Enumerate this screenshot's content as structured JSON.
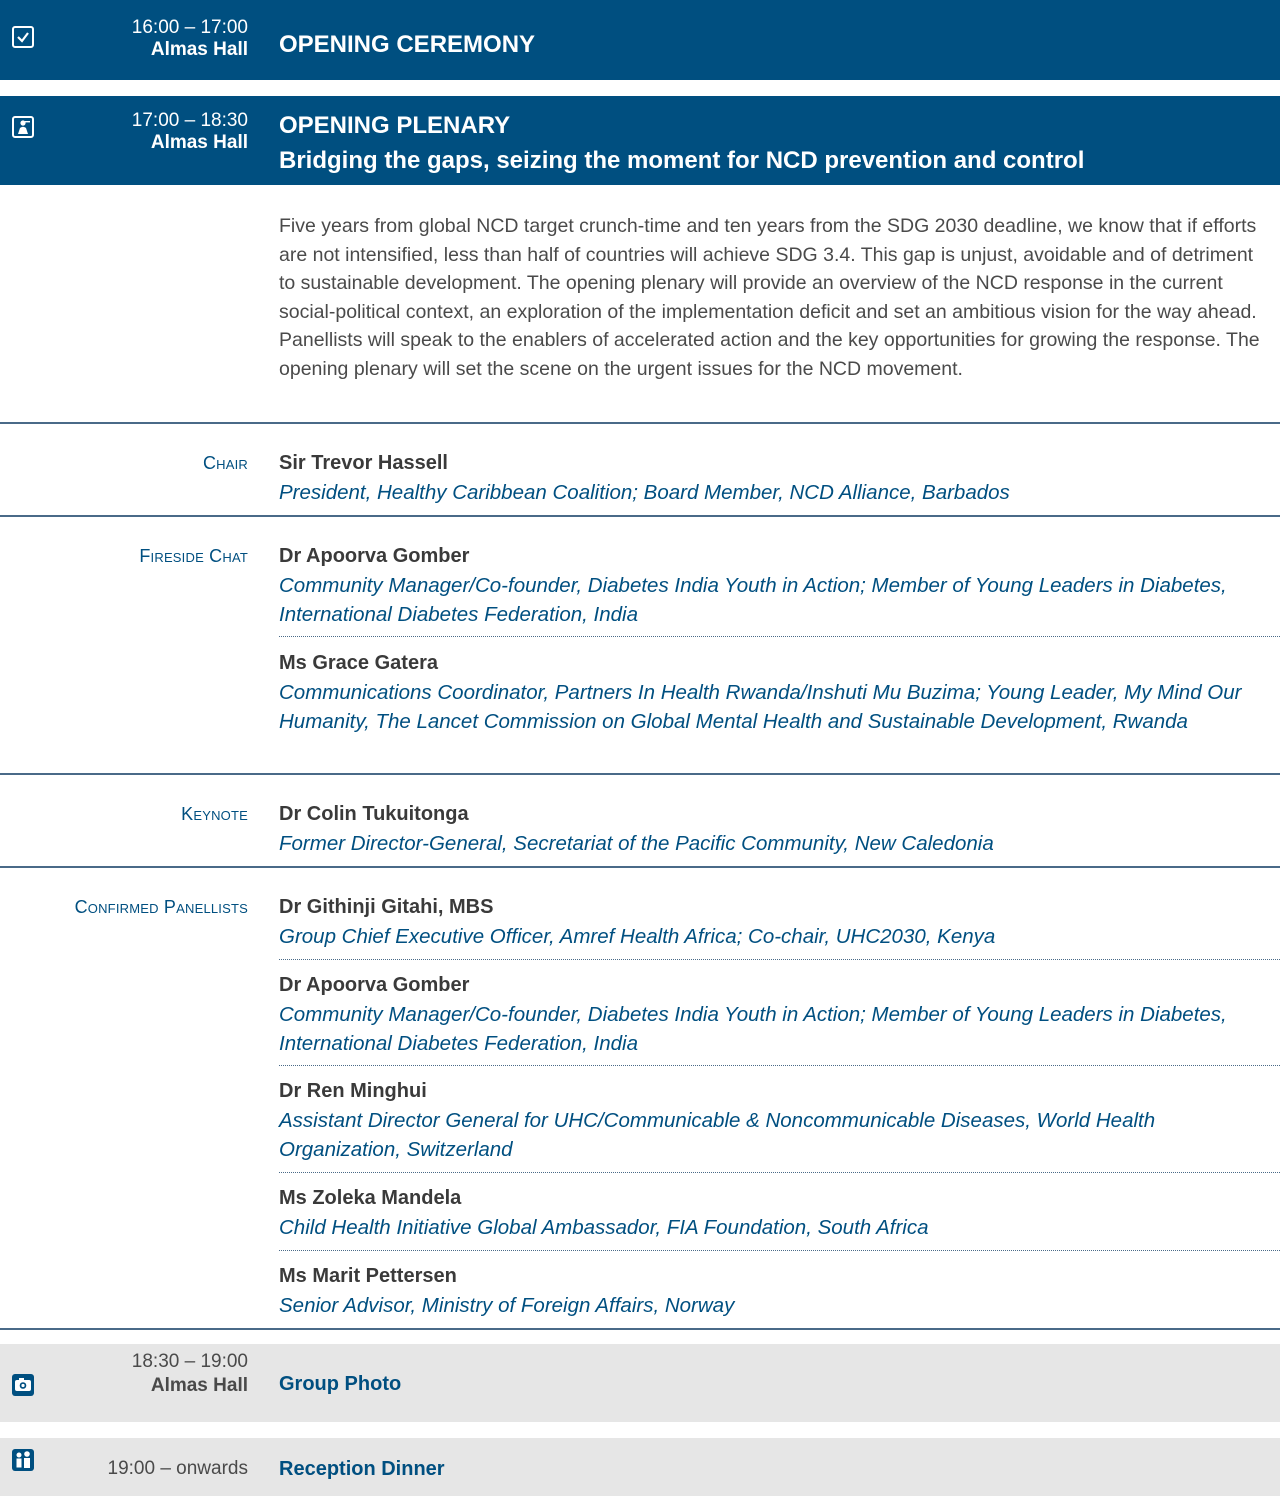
{
  "sessions": [
    {
      "time": "16:00 – 17:00",
      "venue": "Almas Hall",
      "title": "OPENING CEREMONY",
      "icon": "checkbox-icon"
    },
    {
      "time": "17:00 – 18:30",
      "venue": "Almas Hall",
      "title": "OPENING PLENARY",
      "subtitle": "Bridging the gaps, seizing the moment for NCD prevention and control",
      "icon": "presenter-icon"
    },
    {
      "time": "18:30 – 19:00",
      "venue": "Almas Hall",
      "title": "Group Photo",
      "icon": "camera-icon"
    },
    {
      "time": "19:00 – onwards",
      "title": "Reception Dinner",
      "icon": "people-icon"
    }
  ],
  "description": "Five years from global NCD target crunch-time and ten years from the SDG 2030 deadline, we know that if efforts are not intensified, less than half of countries will achieve SDG 3.4. This gap is unjust, avoidable and of detriment to sustainable development. The opening plenary will provide an overview of the NCD response in the current social-political context, an exploration of the implementation deficit and set an ambitious vision for the way ahead. Panellists will speak to the enablers of accelerated action and the key opportunities for growing the response. The opening plenary will set the scene on the urgent issues for the NCD movement.",
  "roles": {
    "chair": "Chair",
    "fireside": "Fireside Chat",
    "keynote": "Keynote",
    "panellists": "Confirmed Panellists"
  },
  "people": [
    {
      "name": "Sir Trevor Hassell",
      "affiliation": "President, Healthy Caribbean Coalition; Board Member, NCD Alliance, Barbados"
    },
    {
      "name": "Dr Apoorva Gomber",
      "affiliation": "Community Manager/Co-founder, Diabetes India Youth in Action; Member of Young Leaders in Diabetes, International Diabetes Federation, India"
    },
    {
      "name": "Ms Grace Gatera",
      "affiliation": "Communications Coordinator, Partners In Health Rwanda/Inshuti Mu Buzima; Young Leader, My Mind Our Humanity, The Lancet Commission on Global Mental Health and Sustainable Development, Rwanda"
    },
    {
      "name": "Dr Colin Tukuitonga",
      "affiliation": "Former Director-General, Secretariat of the Pacific Community, New Caledonia"
    },
    {
      "name": "Dr Githinji Gitahi, MBS",
      "affiliation": "Group Chief Executive Officer, Amref Health Africa; Co-chair, UHC2030, Kenya"
    },
    {
      "name": "Dr Apoorva Gomber",
      "affiliation": "Community Manager/Co-founder, Diabetes India Youth in Action; Member of Young Leaders in Diabetes, International Diabetes Federation, India"
    },
    {
      "name": "Dr Ren Minghui",
      "affiliation": "Assistant Director General for UHC/Communicable & Noncommunicable Diseases, World Health Organization, Switzerland"
    },
    {
      "name": "Ms Zoleka Mandela",
      "affiliation": "Child Health Initiative Global Ambassador, FIA Foundation, South Africa"
    },
    {
      "name": "Ms Marit Pettersen",
      "affiliation": "Senior Advisor, Ministry of Foreign Affairs, Norway"
    }
  ],
  "colors": {
    "primary": "#004f80",
    "grey_band": "#e6e6e6",
    "text": "#4a4a4a"
  }
}
